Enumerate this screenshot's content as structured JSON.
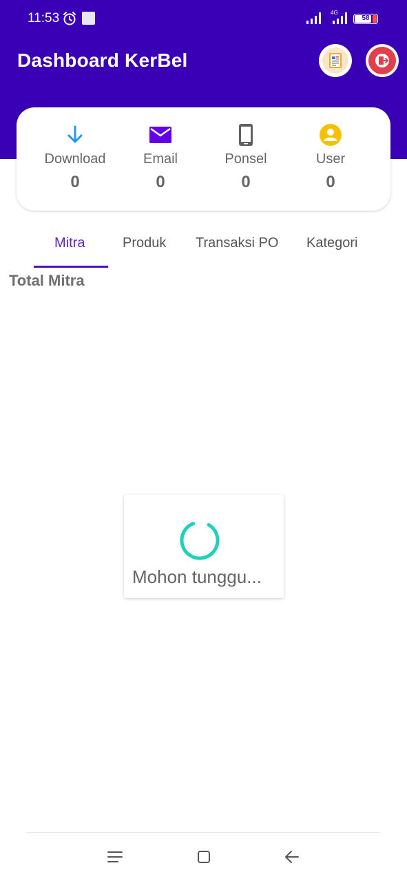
{
  "status_bar": {
    "time": "11:53",
    "network": "4G",
    "battery": "58",
    "icons": [
      "alarm-icon",
      "notification-square-icon",
      "signal-icon",
      "signal-4g-icon",
      "battery-icon"
    ]
  },
  "header": {
    "title": "Dashboard KerBel",
    "background_color": "#3a00b6",
    "buttons": [
      {
        "name": "report-button",
        "icon": "report-icon"
      },
      {
        "name": "logout-button",
        "icon": "logout-icon"
      }
    ]
  },
  "stats": [
    {
      "label": "Download",
      "value": "0",
      "icon": "download-arrow-icon",
      "color": "#2196f3"
    },
    {
      "label": "Email",
      "value": "0",
      "icon": "email-icon",
      "color": "#6200ea"
    },
    {
      "label": "Ponsel",
      "value": "0",
      "icon": "phone-icon",
      "color": "#616161"
    },
    {
      "label": "User",
      "value": "0",
      "icon": "user-icon",
      "color": "#f5c000"
    }
  ],
  "tabs": [
    {
      "label": "Mitra",
      "active": true
    },
    {
      "label": "Produk",
      "active": false
    },
    {
      "label": "Transaksi PO",
      "active": false
    },
    {
      "label": "Kategori",
      "active": false
    }
  ],
  "section": {
    "title": "Total Mitra"
  },
  "loading": {
    "text": "Mohon tunggu...",
    "spinner_color": "#1fd1bd"
  },
  "nav_bar": {
    "buttons": [
      "menu-icon",
      "home-square-icon",
      "back-arrow-icon"
    ]
  }
}
